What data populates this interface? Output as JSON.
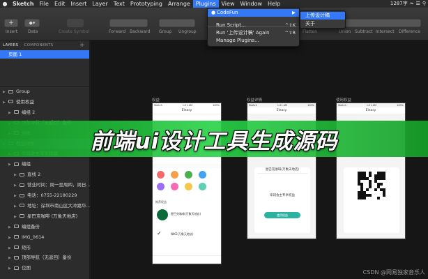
{
  "menubar": {
    "app": "Sketch",
    "items": [
      "File",
      "Edit",
      "Insert",
      "Layer",
      "Text",
      "Prototyping",
      "Arrange",
      "Plugins",
      "View",
      "Window",
      "Help"
    ],
    "active": "Plugins",
    "status": "1287字"
  },
  "toolbar": {
    "insert": "Insert",
    "data": "Data",
    "create_symbol": "Create Symbol",
    "forward": "Forward",
    "backward": "Backward",
    "group": "Group",
    "ungroup": "Ungroup",
    "flatten": "Flatten",
    "union": "Union",
    "subtract": "Subtract",
    "intersect": "Intersect",
    "difference": "Difference"
  },
  "plugins_menu": {
    "codefun": "CodeFun",
    "run_script": "Run Script...",
    "run_script_shortcut": "^⇧K",
    "run_again": "Run '上传设计稿' Again",
    "run_again_shortcut": "^⇧R",
    "manage": "Manage Plugins..."
  },
  "codefun_submenu": {
    "upload": "上传设计稿",
    "about": "关于"
  },
  "sidebar": {
    "tab_layers": "LAYERS",
    "tab_components": "COMPONENTS",
    "page": "页面 1",
    "layers": [
      {
        "label": "Group",
        "indent": 0
      },
      {
        "label": "使用权益",
        "indent": 0
      },
      {
        "label": "编组 2",
        "indent": 1
      },
      {
        "label": "顶部导航（无返回）备份",
        "indent": 1
      },
      {
        "label": "矩形",
        "indent": 1
      },
      {
        "label": "权益详情",
        "indent": 0
      },
      {
        "label": "华润会主专享权益",
        "indent": 1
      },
      {
        "label": "编组",
        "indent": 1
      },
      {
        "label": "直线 2",
        "indent": 2
      },
      {
        "label": "营业时间：周一至周四，周日…",
        "indent": 2
      },
      {
        "label": "电话：0755-22180229",
        "indent": 2
      },
      {
        "label": "地址：深圳市南山区大冲路华…",
        "indent": 2
      },
      {
        "label": "星巴克咖啡 (万象天地店)",
        "indent": 2
      },
      {
        "label": "编组备份",
        "indent": 1
      },
      {
        "label": "IMG_0614",
        "indent": 1
      },
      {
        "label": "矩形",
        "indent": 1
      },
      {
        "label": "顶部导航（无返回）备份",
        "indent": 1
      },
      {
        "label": "位图",
        "indent": 1
      }
    ]
  },
  "canvas": {
    "artboard1": "权益",
    "artboard2": "权益详情",
    "artboard3": "使用权益",
    "app_title": "Eleasy",
    "store_name": "星巴克咖啡(万象天地店)",
    "store_short": "星巴克咖啡 (万象天地店)",
    "nike": "NIKE(万象天地店)",
    "benefit": "华润会主专享权益",
    "use_button": "使用权益",
    "recommend": "推荐权益"
  },
  "banner": "前端ui设计工具生成源码",
  "watermark": "CSDN @网易独家音乐人"
}
